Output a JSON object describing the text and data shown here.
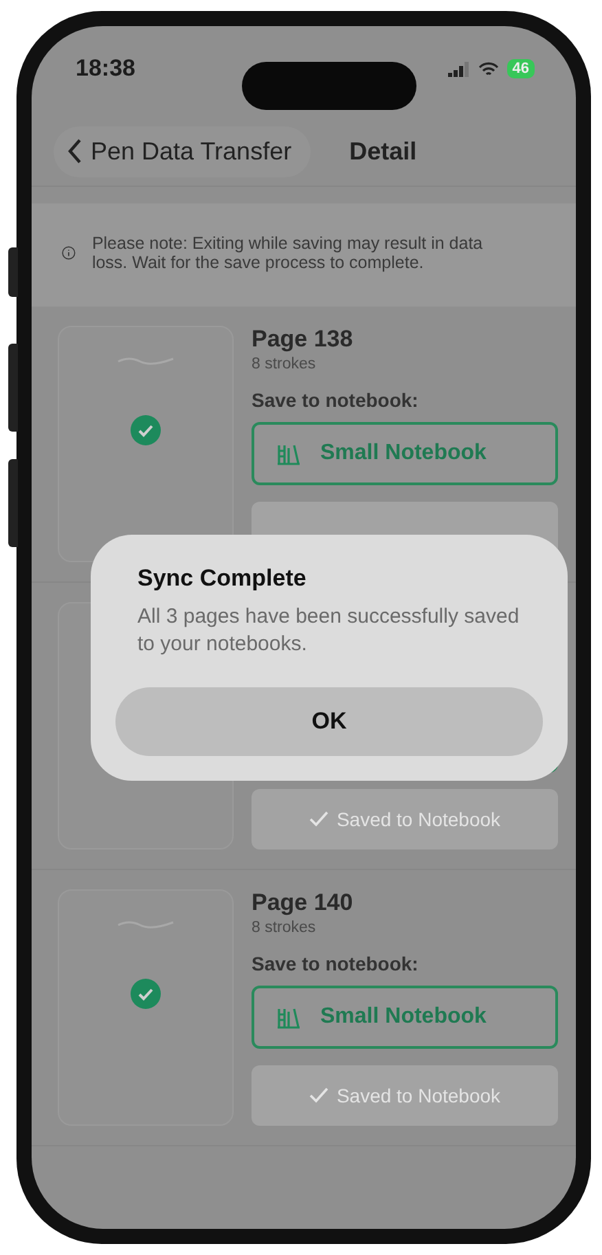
{
  "status_bar": {
    "time": "18:38",
    "battery": "46"
  },
  "nav": {
    "back_label": "Pen Data Transfer",
    "title": "Detail"
  },
  "notice": "Please note: Exiting while saving may result in data loss. Wait for the save process to complete.",
  "pages": [
    {
      "title": "Page 138",
      "strokes": "8 strokes",
      "save_label": "Save to notebook:",
      "notebook": "Small Notebook",
      "saved": true
    },
    {
      "saved_button": "Saved to Notebook"
    },
    {
      "title": "Page 140",
      "strokes": "8 strokes",
      "save_label": "Save to notebook:",
      "notebook": "Small Notebook",
      "saved": true,
      "saved_button": "Saved to Notebook"
    }
  ],
  "dialog": {
    "title": "Sync Complete",
    "message": "All 3 pages have been successfully saved to your notebooks.",
    "button": "OK"
  }
}
